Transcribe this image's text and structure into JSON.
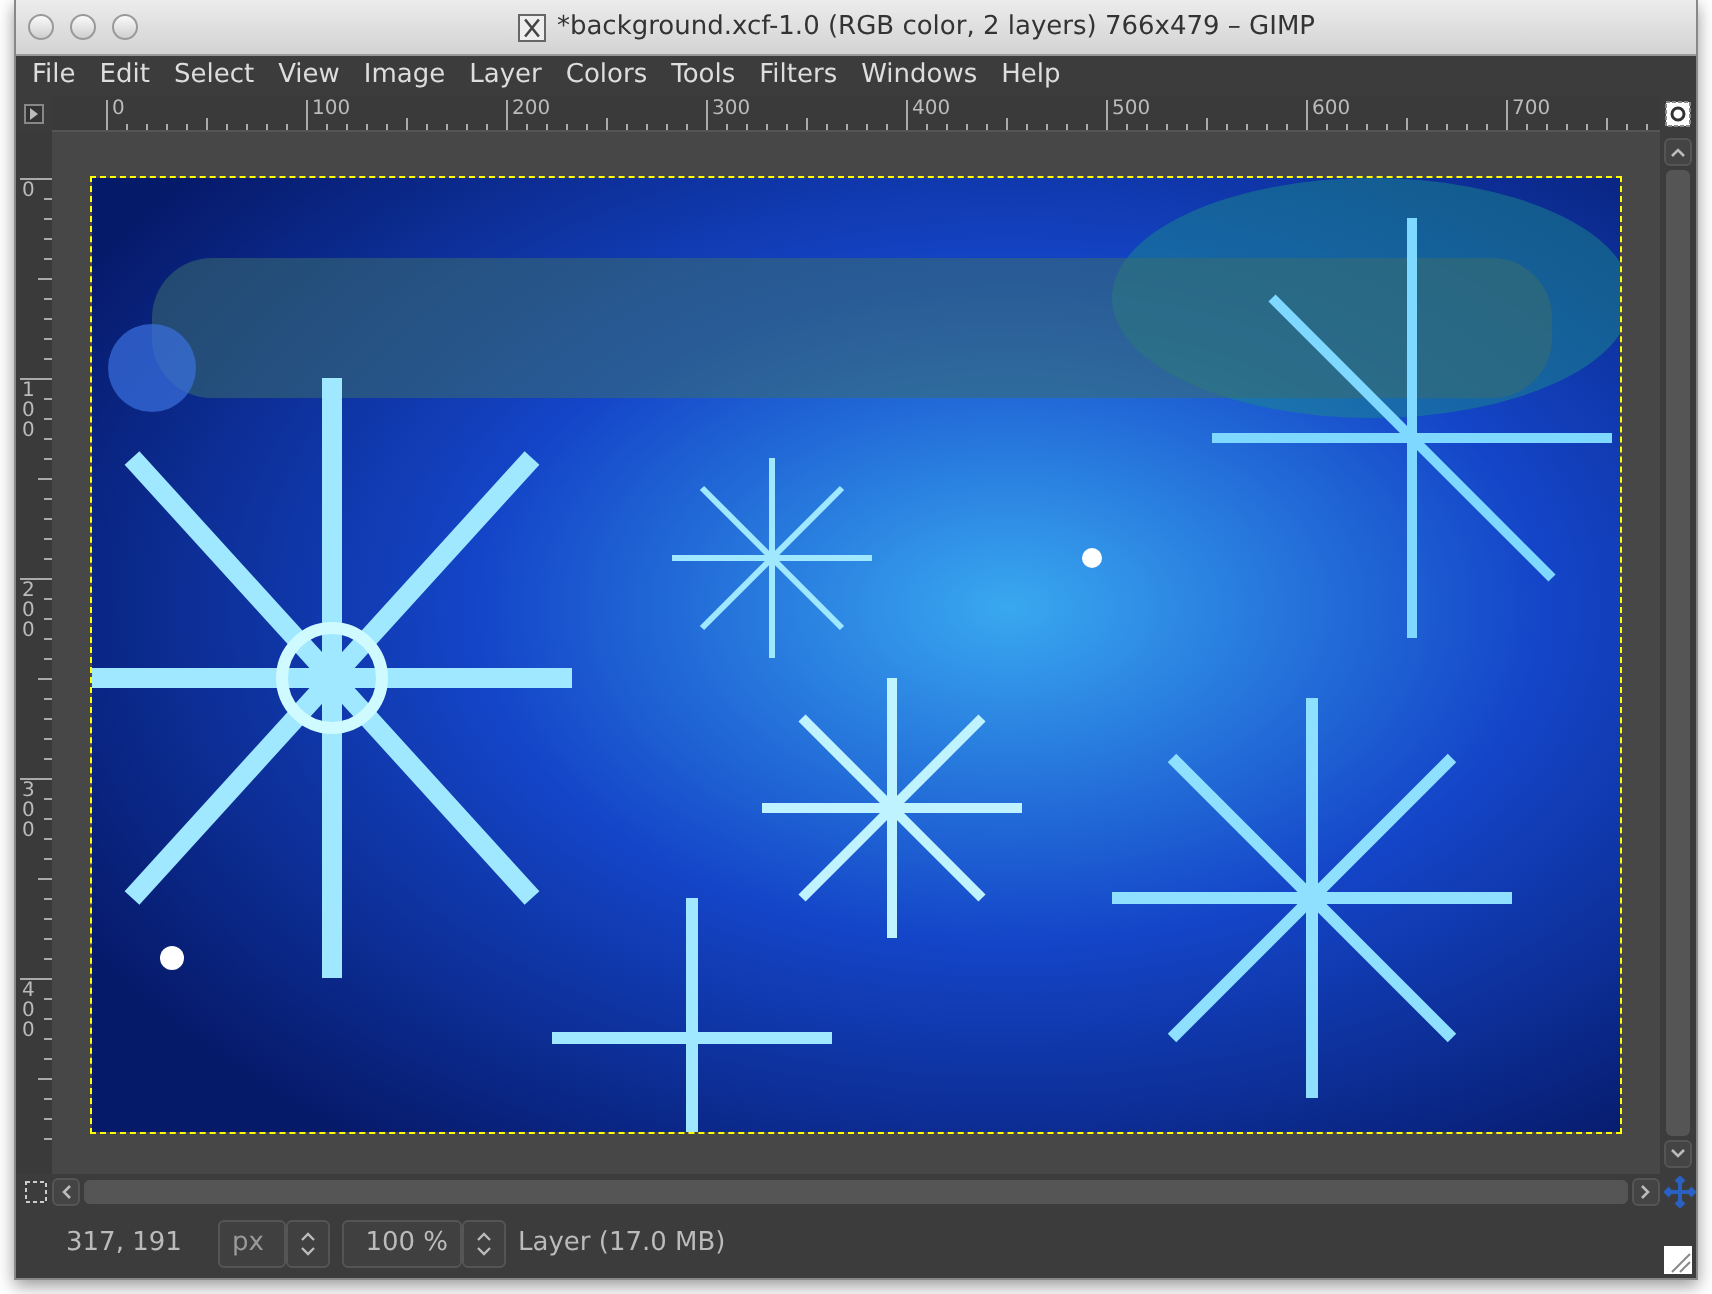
{
  "window": {
    "title": "*background.xcf-1.0 (RGB color, 2 layers) 766x479 – GIMP"
  },
  "menu": [
    "File",
    "Edit",
    "Select",
    "View",
    "Image",
    "Layer",
    "Colors",
    "Tools",
    "Filters",
    "Windows",
    "Help"
  ],
  "rulers": {
    "horizontal": [
      "0",
      "100",
      "200",
      "300",
      "400",
      "500",
      "600",
      "700"
    ],
    "vertical": [
      "0",
      "100",
      "200",
      "300",
      "400"
    ]
  },
  "status_bar": {
    "pointer": "317, 191",
    "unit": "px",
    "zoom": "100 %",
    "layer_info": "Layer (17.0 MB)"
  }
}
